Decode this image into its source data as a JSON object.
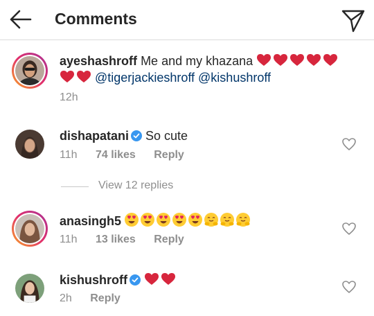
{
  "header": {
    "title": "Comments"
  },
  "caption": {
    "username": "ayeshashroff",
    "text": "Me and my khazana",
    "mention1": "@tigerjackieshroff",
    "mention2": "@kishushroff",
    "time": "12h",
    "hearts_line1": 5,
    "hearts_line2": 2
  },
  "comments": [
    {
      "username": "dishapatani",
      "verified": true,
      "text": "So cute",
      "time": "11h",
      "likes": "74 likes",
      "reply_label": "Reply"
    },
    {
      "username": "anasingh5",
      "verified": false,
      "emojis": [
        "heart-eyes",
        "heart-eyes",
        "heart-eyes",
        "heart-eyes",
        "heart-eyes",
        "hugging",
        "hugging",
        "hugging"
      ],
      "time": "11h",
      "likes": "13 likes",
      "reply_label": "Reply"
    },
    {
      "username": "kishushroff",
      "verified": true,
      "hearts": 2,
      "time": "2h",
      "reply_label": "Reply"
    }
  ],
  "view_replies": "View 12 replies",
  "colors": {
    "text": "#262626",
    "secondary": "#8e8e8e",
    "mention": "#003569",
    "verified": "#3897f0",
    "heart": "#e0245e"
  },
  "icons": [
    "back-arrow-icon",
    "send-icon",
    "verified-icon",
    "like-heart-icon"
  ]
}
